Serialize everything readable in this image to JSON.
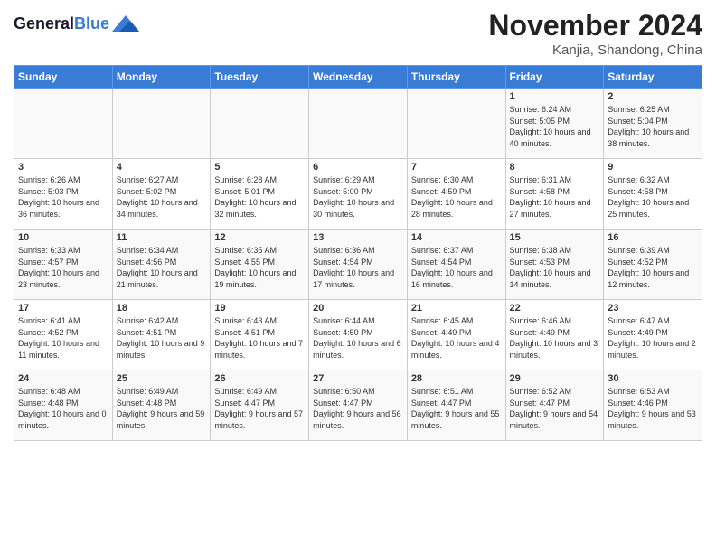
{
  "header": {
    "logo_line1": "General",
    "logo_line2": "Blue",
    "month_title": "November 2024",
    "location": "Kanjia, Shandong, China"
  },
  "weekdays": [
    "Sunday",
    "Monday",
    "Tuesday",
    "Wednesday",
    "Thursday",
    "Friday",
    "Saturday"
  ],
  "weeks": [
    [
      {
        "day": "",
        "info": ""
      },
      {
        "day": "",
        "info": ""
      },
      {
        "day": "",
        "info": ""
      },
      {
        "day": "",
        "info": ""
      },
      {
        "day": "",
        "info": ""
      },
      {
        "day": "1",
        "info": "Sunrise: 6:24 AM\nSunset: 5:05 PM\nDaylight: 10 hours and 40 minutes."
      },
      {
        "day": "2",
        "info": "Sunrise: 6:25 AM\nSunset: 5:04 PM\nDaylight: 10 hours and 38 minutes."
      }
    ],
    [
      {
        "day": "3",
        "info": "Sunrise: 6:26 AM\nSunset: 5:03 PM\nDaylight: 10 hours and 36 minutes."
      },
      {
        "day": "4",
        "info": "Sunrise: 6:27 AM\nSunset: 5:02 PM\nDaylight: 10 hours and 34 minutes."
      },
      {
        "day": "5",
        "info": "Sunrise: 6:28 AM\nSunset: 5:01 PM\nDaylight: 10 hours and 32 minutes."
      },
      {
        "day": "6",
        "info": "Sunrise: 6:29 AM\nSunset: 5:00 PM\nDaylight: 10 hours and 30 minutes."
      },
      {
        "day": "7",
        "info": "Sunrise: 6:30 AM\nSunset: 4:59 PM\nDaylight: 10 hours and 28 minutes."
      },
      {
        "day": "8",
        "info": "Sunrise: 6:31 AM\nSunset: 4:58 PM\nDaylight: 10 hours and 27 minutes."
      },
      {
        "day": "9",
        "info": "Sunrise: 6:32 AM\nSunset: 4:58 PM\nDaylight: 10 hours and 25 minutes."
      }
    ],
    [
      {
        "day": "10",
        "info": "Sunrise: 6:33 AM\nSunset: 4:57 PM\nDaylight: 10 hours and 23 minutes."
      },
      {
        "day": "11",
        "info": "Sunrise: 6:34 AM\nSunset: 4:56 PM\nDaylight: 10 hours and 21 minutes."
      },
      {
        "day": "12",
        "info": "Sunrise: 6:35 AM\nSunset: 4:55 PM\nDaylight: 10 hours and 19 minutes."
      },
      {
        "day": "13",
        "info": "Sunrise: 6:36 AM\nSunset: 4:54 PM\nDaylight: 10 hours and 17 minutes."
      },
      {
        "day": "14",
        "info": "Sunrise: 6:37 AM\nSunset: 4:54 PM\nDaylight: 10 hours and 16 minutes."
      },
      {
        "day": "15",
        "info": "Sunrise: 6:38 AM\nSunset: 4:53 PM\nDaylight: 10 hours and 14 minutes."
      },
      {
        "day": "16",
        "info": "Sunrise: 6:39 AM\nSunset: 4:52 PM\nDaylight: 10 hours and 12 minutes."
      }
    ],
    [
      {
        "day": "17",
        "info": "Sunrise: 6:41 AM\nSunset: 4:52 PM\nDaylight: 10 hours and 11 minutes."
      },
      {
        "day": "18",
        "info": "Sunrise: 6:42 AM\nSunset: 4:51 PM\nDaylight: 10 hours and 9 minutes."
      },
      {
        "day": "19",
        "info": "Sunrise: 6:43 AM\nSunset: 4:51 PM\nDaylight: 10 hours and 7 minutes."
      },
      {
        "day": "20",
        "info": "Sunrise: 6:44 AM\nSunset: 4:50 PM\nDaylight: 10 hours and 6 minutes."
      },
      {
        "day": "21",
        "info": "Sunrise: 6:45 AM\nSunset: 4:49 PM\nDaylight: 10 hours and 4 minutes."
      },
      {
        "day": "22",
        "info": "Sunrise: 6:46 AM\nSunset: 4:49 PM\nDaylight: 10 hours and 3 minutes."
      },
      {
        "day": "23",
        "info": "Sunrise: 6:47 AM\nSunset: 4:49 PM\nDaylight: 10 hours and 2 minutes."
      }
    ],
    [
      {
        "day": "24",
        "info": "Sunrise: 6:48 AM\nSunset: 4:48 PM\nDaylight: 10 hours and 0 minutes."
      },
      {
        "day": "25",
        "info": "Sunrise: 6:49 AM\nSunset: 4:48 PM\nDaylight: 9 hours and 59 minutes."
      },
      {
        "day": "26",
        "info": "Sunrise: 6:49 AM\nSunset: 4:47 PM\nDaylight: 9 hours and 57 minutes."
      },
      {
        "day": "27",
        "info": "Sunrise: 6:50 AM\nSunset: 4:47 PM\nDaylight: 9 hours and 56 minutes."
      },
      {
        "day": "28",
        "info": "Sunrise: 6:51 AM\nSunset: 4:47 PM\nDaylight: 9 hours and 55 minutes."
      },
      {
        "day": "29",
        "info": "Sunrise: 6:52 AM\nSunset: 4:47 PM\nDaylight: 9 hours and 54 minutes."
      },
      {
        "day": "30",
        "info": "Sunrise: 6:53 AM\nSunset: 4:46 PM\nDaylight: 9 hours and 53 minutes."
      }
    ]
  ]
}
